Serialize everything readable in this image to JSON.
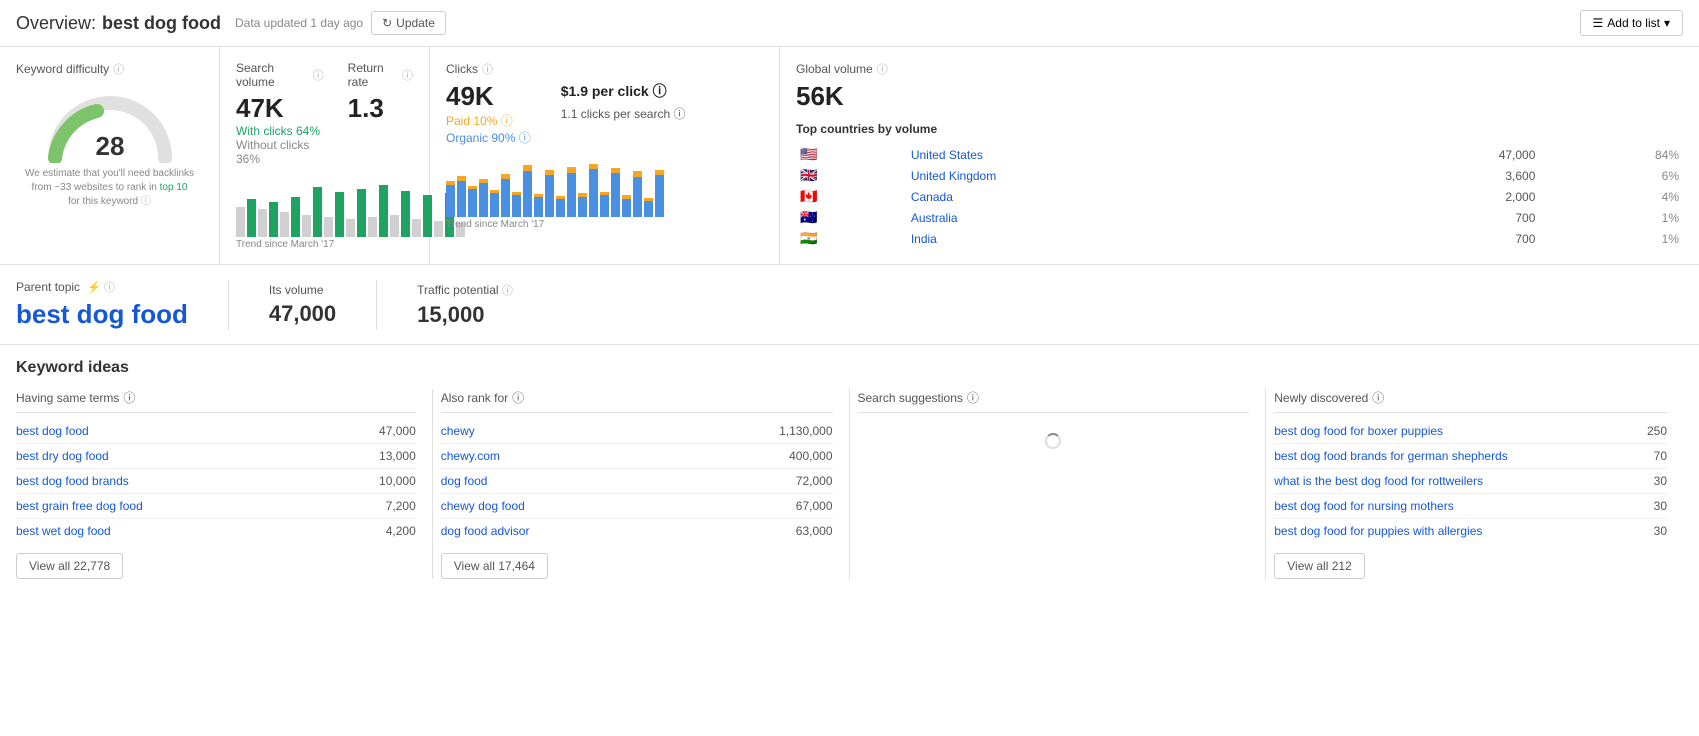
{
  "header": {
    "overview_label": "Overview:",
    "keyword": "best dog food",
    "updated_text": "Data updated 1 day ago",
    "update_btn": "Update",
    "add_to_list_btn": "Add to list"
  },
  "keyword_difficulty": {
    "label": "Keyword difficulty",
    "value": "28",
    "note": "We estimate that you'll need backlinks from ~33 websites to rank in top 10 for this keyword"
  },
  "search_volume": {
    "label": "Search volume",
    "value": "47K",
    "with_clicks": "With clicks 64%",
    "without_clicks": "Without clicks 36%",
    "trend_label": "Trend since March '17"
  },
  "return_rate": {
    "label": "Return rate",
    "value": "1.3"
  },
  "clicks": {
    "label": "Clicks",
    "value": "49K",
    "cpc": "$1.9 per click",
    "cps": "1.1 clicks per search",
    "paid": "Paid 10%",
    "organic": "Organic 90%",
    "trend_label": "Trend since March '17"
  },
  "global_volume": {
    "label": "Global volume",
    "value": "56K",
    "top_countries_label": "Top countries by volume",
    "countries": [
      {
        "name": "United States",
        "flag": "us",
        "volume": "47,000",
        "pct": "84%"
      },
      {
        "name": "United Kingdom",
        "flag": "gb",
        "volume": "3,600",
        "pct": "6%"
      },
      {
        "name": "Canada",
        "flag": "ca",
        "volume": "2,000",
        "pct": "4%"
      },
      {
        "name": "Australia",
        "flag": "au",
        "volume": "700",
        "pct": "1%"
      },
      {
        "name": "India",
        "flag": "in",
        "volume": "700",
        "pct": "1%"
      }
    ]
  },
  "parent_topic": {
    "label": "Parent topic",
    "value": "best dog food",
    "volume_label": "Its volume",
    "volume": "47,000",
    "traffic_label": "Traffic potential",
    "traffic": "15,000"
  },
  "keyword_ideas": {
    "title": "Keyword ideas",
    "same_terms": {
      "label": "Having same terms",
      "items": [
        {
          "kw": "best dog food",
          "vol": "47,000"
        },
        {
          "kw": "best dry dog food",
          "vol": "13,000"
        },
        {
          "kw": "best dog food brands",
          "vol": "10,000"
        },
        {
          "kw": "best grain free dog food",
          "vol": "7,200"
        },
        {
          "kw": "best wet dog food",
          "vol": "4,200"
        }
      ],
      "view_all": "View all 22,778"
    },
    "also_rank": {
      "label": "Also rank for",
      "items": [
        {
          "kw": "chewy",
          "vol": "1,130,000"
        },
        {
          "kw": "chewy.com",
          "vol": "400,000"
        },
        {
          "kw": "dog food",
          "vol": "72,000"
        },
        {
          "kw": "chewy dog food",
          "vol": "67,000"
        },
        {
          "kw": "dog food advisor",
          "vol": "63,000"
        }
      ],
      "view_all": "View all 17,464"
    },
    "search_suggestions": {
      "label": "Search suggestions",
      "items": []
    },
    "newly_discovered": {
      "label": "Newly discovered",
      "items": [
        {
          "kw": "best dog food for boxer puppies",
          "vol": "250"
        },
        {
          "kw": "best dog food brands for german shepherds",
          "vol": "70"
        },
        {
          "kw": "what is the best dog food for rottweilers",
          "vol": "30"
        },
        {
          "kw": "best dog food for nursing mothers",
          "vol": "30"
        },
        {
          "kw": "best dog food for puppies with allergies",
          "vol": "30"
        }
      ],
      "view_all": "View all 212"
    }
  }
}
